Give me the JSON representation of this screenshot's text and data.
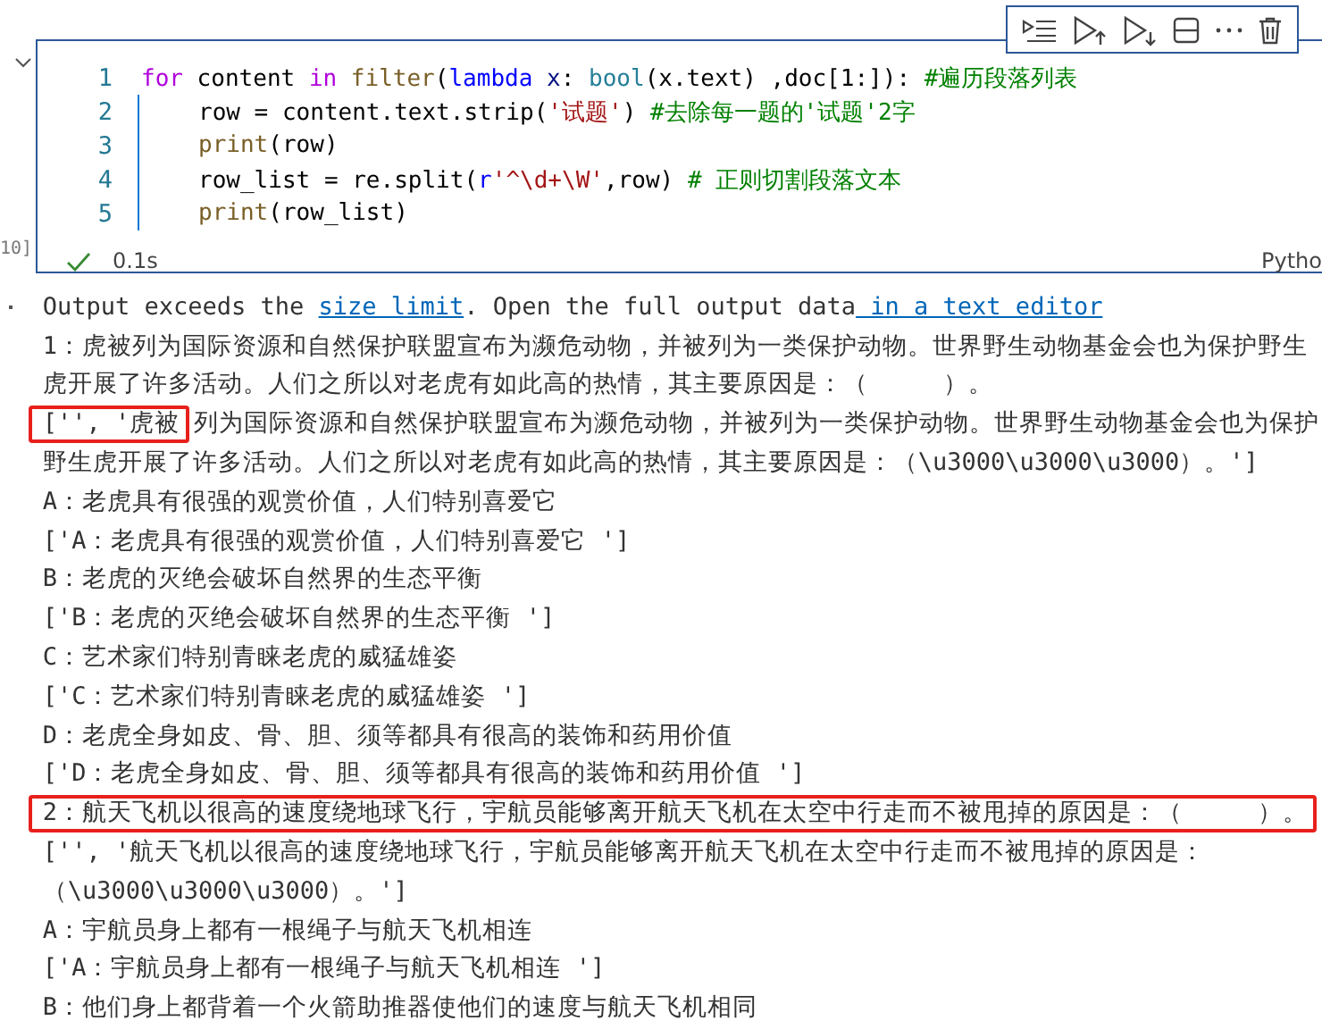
{
  "cell_toolbar": {
    "buttons": [
      {
        "kind": "run-lines"
      },
      {
        "kind": "run-above"
      },
      {
        "kind": "run-below"
      },
      {
        "kind": "split"
      },
      {
        "kind": "more"
      },
      {
        "kind": "delete"
      }
    ]
  },
  "cell": {
    "execution_count": "10]",
    "collapsed": false,
    "code_lines": [
      {
        "number": "1",
        "indented": false,
        "tokens": [
          {
            "text": "for",
            "kind": "control"
          },
          {
            "text": " content ",
            "kind": "plain"
          },
          {
            "text": "in ",
            "kind": "control"
          },
          {
            "text": "filter",
            "kind": "function"
          },
          {
            "text": "(",
            "kind": "plain"
          },
          {
            "text": "lambda ",
            "kind": "keyword"
          },
          {
            "text": "x",
            "kind": "variable"
          },
          {
            "text": ": ",
            "kind": "plain"
          },
          {
            "text": "bool",
            "kind": "builtin"
          },
          {
            "text": "(x.text) ,doc[1:]): ",
            "kind": "plain"
          },
          {
            "text": "#遍历段落列表",
            "kind": "comment"
          }
        ]
      },
      {
        "number": "2",
        "indented": true,
        "tokens": [
          {
            "text": "row = content.text.strip(",
            "kind": "plain"
          },
          {
            "text": "'试题'",
            "kind": "string"
          },
          {
            "text": ") ",
            "kind": "plain"
          },
          {
            "text": "#去除每一题的'试题'2字",
            "kind": "comment"
          }
        ]
      },
      {
        "number": "3",
        "indented": true,
        "tokens": [
          {
            "text": "print",
            "kind": "function"
          },
          {
            "text": "(row)",
            "kind": "plain"
          }
        ]
      },
      {
        "number": "4",
        "indented": true,
        "tokens": [
          {
            "text": "row_list = re.split(",
            "kind": "plain"
          },
          {
            "text": "r",
            "kind": "keyword"
          },
          {
            "text": "'^\\d+\\W'",
            "kind": "string"
          },
          {
            "text": ",row) ",
            "kind": "plain"
          },
          {
            "text": "# 正则切割段落文本",
            "kind": "comment"
          }
        ]
      },
      {
        "number": "5",
        "indented": true,
        "tokens": [
          {
            "text": "print",
            "kind": "function"
          },
          {
            "text": "(row_list)",
            "kind": "plain"
          }
        ]
      }
    ],
    "status": {
      "succeeded": true,
      "duration": "0.1s",
      "language": "Pytho"
    }
  },
  "output": {
    "lines": [
      {
        "parts": [
          {
            "text": "Output exceeds the ",
            "kind": "text",
            "boxed": false
          },
          {
            "text": "size limit",
            "kind": "link",
            "boxed": false
          },
          {
            "text": ". Open the full output data",
            "kind": "text",
            "boxed": false
          },
          {
            "text": " in a text editor",
            "kind": "link",
            "boxed": false
          }
        ]
      },
      {
        "parts": [
          {
            "text": "1：虎被列为国际资源和自然保护联盟宣布为濒危动物，并被列为一类保护动物。世界野生动物基金会也为保护野生",
            "kind": "text",
            "boxed": false
          }
        ]
      },
      {
        "parts": [
          {
            "text": "虎开展了许多活动。人们之所以对老虎有如此高的热情，其主要原因是：（　　　）。",
            "kind": "text",
            "boxed": false
          }
        ]
      },
      {
        "parts": [
          {
            "text": "['', '虎被",
            "kind": "text",
            "boxed": true
          },
          {
            "text": "列为国际资源和自然保护联盟宣布为濒危动物，并被列为一类保护动物。世界野生动物基金会也为保护",
            "kind": "text",
            "boxed": false
          }
        ]
      },
      {
        "parts": [
          {
            "text": "野生虎开展了许多活动。人们之所以对老虎有如此高的热情，其主要原因是：（\\u3000\\u3000\\u3000）。']",
            "kind": "text",
            "boxed": false
          }
        ]
      },
      {
        "parts": [
          {
            "text": "A：老虎具有很强的观赏价值，人们特别喜爱它",
            "kind": "text",
            "boxed": false
          }
        ]
      },
      {
        "parts": [
          {
            "text": "['A：老虎具有很强的观赏价值，人们特别喜爱它 ']",
            "kind": "text",
            "boxed": false
          }
        ]
      },
      {
        "parts": [
          {
            "text": "B：老虎的灭绝会破坏自然界的生态平衡",
            "kind": "text",
            "boxed": false
          }
        ]
      },
      {
        "parts": [
          {
            "text": "['B：老虎的灭绝会破坏自然界的生态平衡 ']",
            "kind": "text",
            "boxed": false
          }
        ]
      },
      {
        "parts": [
          {
            "text": "C：艺术家们特别青睐老虎的威猛雄姿",
            "kind": "text",
            "boxed": false
          }
        ]
      },
      {
        "parts": [
          {
            "text": "['C：艺术家们特别青睐老虎的威猛雄姿 ']",
            "kind": "text",
            "boxed": false
          }
        ]
      },
      {
        "parts": [
          {
            "text": "D：老虎全身如皮、骨、胆、须等都具有很高的装饰和药用价值",
            "kind": "text",
            "boxed": false
          }
        ]
      },
      {
        "parts": [
          {
            "text": "['D：老虎全身如皮、骨、胆、须等都具有很高的装饰和药用价值 ']",
            "kind": "text",
            "boxed": false
          }
        ]
      },
      {
        "parts": [
          {
            "text": "2：航天飞机以很高的速度绕地球飞行，宇航员能够离开航天飞机在太空中行走而不被甩掉的原因是：（　　　）。",
            "kind": "text",
            "boxed": true
          }
        ]
      },
      {
        "parts": [
          {
            "text": "['', '航天飞机以很高的速度绕地球飞行，宇航员能够离开航天飞机在太空中行走而不被甩掉的原因是：",
            "kind": "text",
            "boxed": false
          }
        ]
      },
      {
        "parts": [
          {
            "text": "（\\u3000\\u3000\\u3000）。']",
            "kind": "text",
            "boxed": false
          }
        ]
      },
      {
        "parts": [
          {
            "text": "A：宇航员身上都有一根绳子与航天飞机相连",
            "kind": "text",
            "boxed": false
          }
        ]
      },
      {
        "parts": [
          {
            "text": "['A：宇航员身上都有一根绳子与航天飞机相连 ']",
            "kind": "text",
            "boxed": false
          }
        ]
      },
      {
        "parts": [
          {
            "text": "B：他们身上都背着一个火箭助推器使他们的速度与航天飞机相同",
            "kind": "text",
            "boxed": false
          }
        ]
      }
    ]
  }
}
